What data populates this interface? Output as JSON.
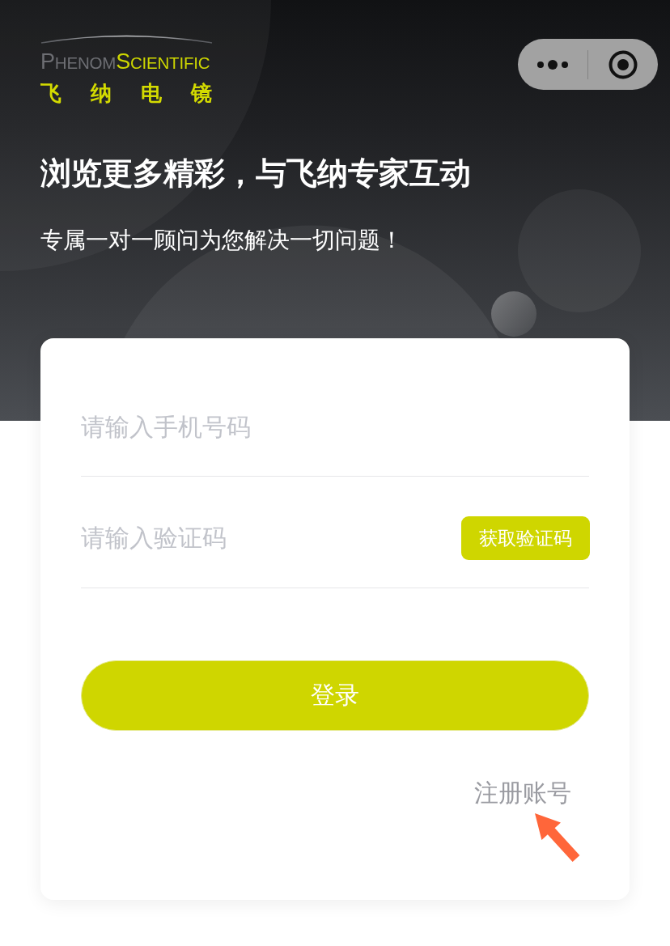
{
  "logo": {
    "brand_left": "PHENOM",
    "brand_right": "SCIENTIFIC",
    "chinese_name": "飞 纳 电 镜"
  },
  "headline": "浏览更多精彩，与飞纳专家互动",
  "subheadline": "专属一对一顾问为您解决一切问题！",
  "form": {
    "phone_field": {
      "placeholder": "请输入手机号码"
    },
    "code_field": {
      "placeholder": "请输入验证码"
    },
    "get_code_button": "获取验证码",
    "login_button": "登录",
    "register_link": "注册账号"
  }
}
